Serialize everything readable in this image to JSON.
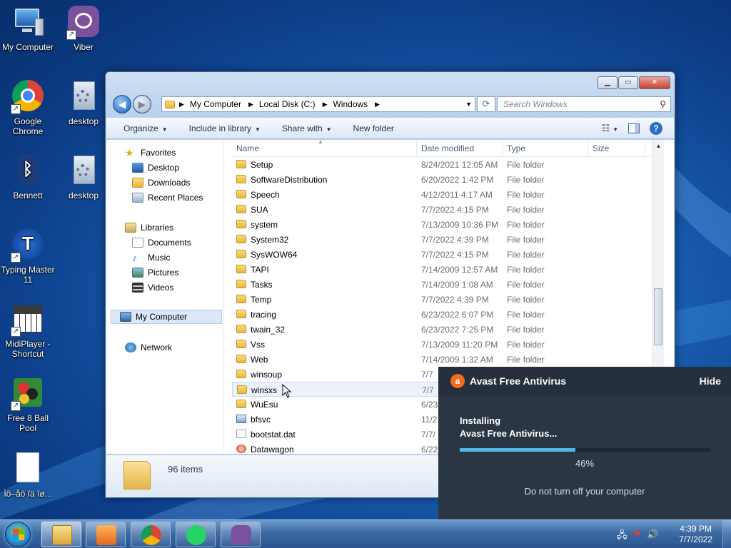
{
  "desktop": {
    "icons": [
      {
        "label": "My Computer",
        "icon": "computer-icon"
      },
      {
        "label": "Viber",
        "icon": "viber-icon"
      },
      {
        "label": "Google Chrome",
        "icon": "chrome-icon"
      },
      {
        "label": "desktop",
        "icon": "settings-file-icon"
      },
      {
        "label": "Bennett",
        "icon": "bluetooth-icon"
      },
      {
        "label": "desktop",
        "icon": "settings-file-icon"
      },
      {
        "label": "Typing Master 11",
        "icon": "typingmaster-icon"
      },
      {
        "label": "MidiPlayer - Shortcut",
        "icon": "piano-icon"
      },
      {
        "label": "Free 8 Ball Pool",
        "icon": "billiard-icon"
      },
      {
        "label": "Ìö–åö ïä ïø...",
        "icon": "blank-file-icon"
      }
    ]
  },
  "explorer": {
    "breadcrumb": [
      "My Computer",
      "Local Disk (C:)",
      "Windows"
    ],
    "search_placeholder": "Search Windows",
    "toolbar": {
      "organize": "Organize",
      "include_in_library": "Include in library",
      "share_with": "Share with",
      "new_folder": "New folder"
    },
    "nav": {
      "favorites": "Favorites",
      "desktop": "Desktop",
      "downloads": "Downloads",
      "recent_places": "Recent Places",
      "libraries": "Libraries",
      "documents": "Documents",
      "music": "Music",
      "pictures": "Pictures",
      "videos": "Videos",
      "my_computer": "My Computer",
      "network": "Network"
    },
    "columns": {
      "name": "Name",
      "date": "Date modified",
      "type": "Type",
      "size": "Size"
    },
    "files": [
      {
        "name": "Setup",
        "date": "8/24/2021 12:05 AM",
        "type": "File folder",
        "kind": "folder"
      },
      {
        "name": "SoftwareDistribution",
        "date": "6/20/2022 1:42 PM",
        "type": "File folder",
        "kind": "folder"
      },
      {
        "name": "Speech",
        "date": "4/12/2011 4:17 AM",
        "type": "File folder",
        "kind": "folder"
      },
      {
        "name": "SUA",
        "date": "7/7/2022 4:15 PM",
        "type": "File folder",
        "kind": "folder"
      },
      {
        "name": "system",
        "date": "7/13/2009 10:36 PM",
        "type": "File folder",
        "kind": "folder"
      },
      {
        "name": "System32",
        "date": "7/7/2022 4:39 PM",
        "type": "File folder",
        "kind": "folder"
      },
      {
        "name": "SysWOW64",
        "date": "7/7/2022 4:15 PM",
        "type": "File folder",
        "kind": "folder"
      },
      {
        "name": "TAPI",
        "date": "7/14/2009 12:57 AM",
        "type": "File folder",
        "kind": "folder"
      },
      {
        "name": "Tasks",
        "date": "7/14/2009 1:08 AM",
        "type": "File folder",
        "kind": "folder"
      },
      {
        "name": "Temp",
        "date": "7/7/2022 4:39 PM",
        "type": "File folder",
        "kind": "folder"
      },
      {
        "name": "tracing",
        "date": "6/23/2022 6:07 PM",
        "type": "File folder",
        "kind": "folder"
      },
      {
        "name": "twain_32",
        "date": "6/23/2022 7:25 PM",
        "type": "File folder",
        "kind": "folder"
      },
      {
        "name": "Vss",
        "date": "7/13/2009 11:20 PM",
        "type": "File folder",
        "kind": "folder"
      },
      {
        "name": "Web",
        "date": "7/14/2009 1:32 AM",
        "type": "File folder",
        "kind": "folder"
      },
      {
        "name": "winsoup",
        "date": "7/7",
        "type": "",
        "kind": "folder"
      },
      {
        "name": "winsxs",
        "date": "7/7",
        "type": "",
        "kind": "folder"
      },
      {
        "name": "WuEsu",
        "date": "6/23",
        "type": "",
        "kind": "folder"
      },
      {
        "name": "bfsvc",
        "date": "11/2",
        "type": "",
        "kind": "exe"
      },
      {
        "name": "bootstat.dat",
        "date": "7/7/",
        "type": "",
        "kind": "file"
      },
      {
        "name": "Datawagon",
        "date": "6/22",
        "type": "",
        "kind": "gear"
      }
    ],
    "status": "96 items"
  },
  "avast": {
    "title": "Avast Free Antivirus",
    "hide": "Hide",
    "line1": "Installing",
    "line2": "Avast Free Antivirus...",
    "progress_percent": 46,
    "percent_label": "46%",
    "warning": "Do not turn off your computer",
    "accent": "#4fb8e8",
    "brand": "#f26b21"
  },
  "taskbar": {
    "time": "4:39 PM",
    "date": "7/7/2022",
    "pinned": [
      "explorer-icon",
      "media-player-icon",
      "chrome-icon",
      "whatsapp-icon",
      "viber-icon"
    ]
  }
}
